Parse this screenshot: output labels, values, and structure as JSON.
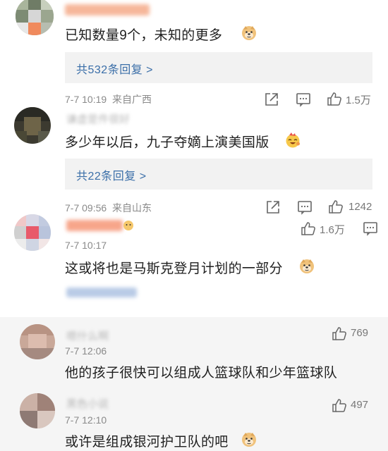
{
  "comments": [
    {
      "text": "已知数量9个，未知的更多",
      "replies_label": "共532条回复 >",
      "time": "7-7 10:19",
      "location": "来自广西",
      "likes": "1.5万",
      "emoji": "doge-emoji"
    },
    {
      "text": "多少年以后，九子夺嫡上演美国版",
      "replies_label": "共22条回复 >",
      "time": "7-7 09:56",
      "location": "来自山东",
      "likes": "1242",
      "emoji": "party-emoji"
    },
    {
      "text": "这或将也是马斯克登月计划的一部分",
      "time": "7-7 10:17",
      "likes": "1.6万",
      "emoji": "doge-emoji"
    }
  ],
  "replies": [
    {
      "text": "他的孩子很快可以组成人篮球队和少年篮球队",
      "time": "7-7 12:06",
      "likes": "769"
    },
    {
      "text": "或许是组成银河护卫队的吧",
      "time": "7-7 12:10",
      "likes": "497",
      "emoji": "doge-emoji"
    }
  ],
  "colors": {
    "link": "#3a6ea8",
    "meta": "#8a8a8a",
    "reply_bg": "#f2f2f2",
    "name_orange": "#f08a5d"
  }
}
